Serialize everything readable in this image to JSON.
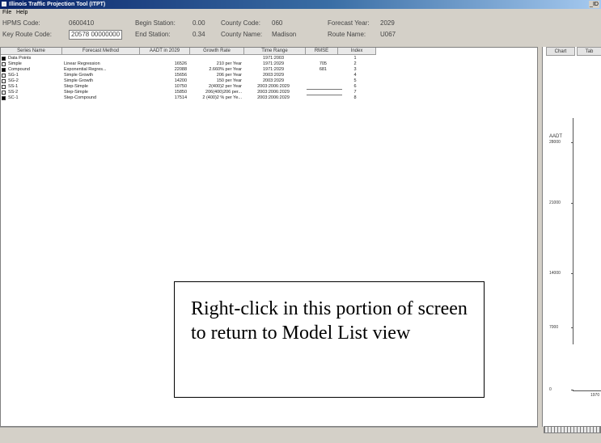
{
  "window": {
    "title": "Illinois Traffic Projection Tool (ITPT)",
    "controls": "_ID"
  },
  "menu": [
    {
      "label": "File"
    },
    {
      "label": "Help"
    }
  ],
  "info": {
    "hpms_label": "HPMS Code:",
    "hpms_value": "0600410",
    "begin_label": "Begin Station:",
    "begin_value": "0.00",
    "county_code_label": "County Code:",
    "county_code_value": "060",
    "forecast_year_label": "Forecast Year:",
    "forecast_year_value": "2029",
    "key_route_label": "Key Route Code:",
    "key_route_value": "20578 00000000",
    "end_label": "End Station:",
    "end_value": "0.34",
    "county_name_label": "County Name:",
    "county_name_value": "Madison",
    "route_name_label": "Route Name:",
    "route_name_value": "U067"
  },
  "table": {
    "headers": [
      "Series Name",
      "Forecast Method",
      "AADT in 2029",
      "Growth Rate",
      "Time Range",
      "RMSE",
      "Index"
    ],
    "rows": [
      {
        "checked": true,
        "name": "Data Points",
        "method": "",
        "aadt": "",
        "growth": "",
        "range": "1971:2003",
        "rmse": "",
        "index": "1"
      },
      {
        "checked": false,
        "name": "Simple",
        "method": "Linear Regression",
        "aadt": "16526",
        "growth": "210 per Year",
        "range": "1971:2029",
        "rmse": "705",
        "index": "2"
      },
      {
        "checked": true,
        "name": "Compound",
        "method": "Exponential Regres...",
        "aadt": "22088",
        "growth": "2.660% per Year",
        "range": "1971:2029",
        "rmse": "681",
        "index": "3"
      },
      {
        "checked": false,
        "name": "SG-1",
        "method": "Simple Growth",
        "aadt": "15656",
        "growth": "206 per Year",
        "range": "2003:2029",
        "rmse": "",
        "index": "4"
      },
      {
        "checked": false,
        "name": "SG-2",
        "method": "Simple Growth",
        "aadt": "14200",
        "growth": "150 per Year",
        "range": "2003:2029",
        "rmse": "",
        "index": "5"
      },
      {
        "checked": false,
        "name": "SS-1",
        "method": "Step-Simple",
        "aadt": "10750",
        "growth": "2(400)2 per Year",
        "range": "2003:2006:2029",
        "rmse": "",
        "index": "6"
      },
      {
        "checked": false,
        "name": "SS-2",
        "method": "Step-Simple",
        "aadt": "15850",
        "growth": "206(400)206 per...",
        "range": "2003:2006:2029",
        "rmse": "",
        "index": "7"
      },
      {
        "checked": true,
        "name": "SC-1",
        "method": "Step-Compound",
        "aadt": "17514",
        "growth": "2 (400)2 % per Ye...",
        "range": "2003:2006:2029",
        "rmse": "",
        "index": "8"
      }
    ]
  },
  "callout": {
    "text": "Right-click in this portion of screen to return to Model List view"
  },
  "chart_panel": {
    "tabs": [
      "Chart",
      "Tab"
    ],
    "y_label": "AADT",
    "y_ticks": [
      "28000",
      "21000",
      "14000",
      "7000",
      "0"
    ],
    "x_first_tick": "1970"
  }
}
